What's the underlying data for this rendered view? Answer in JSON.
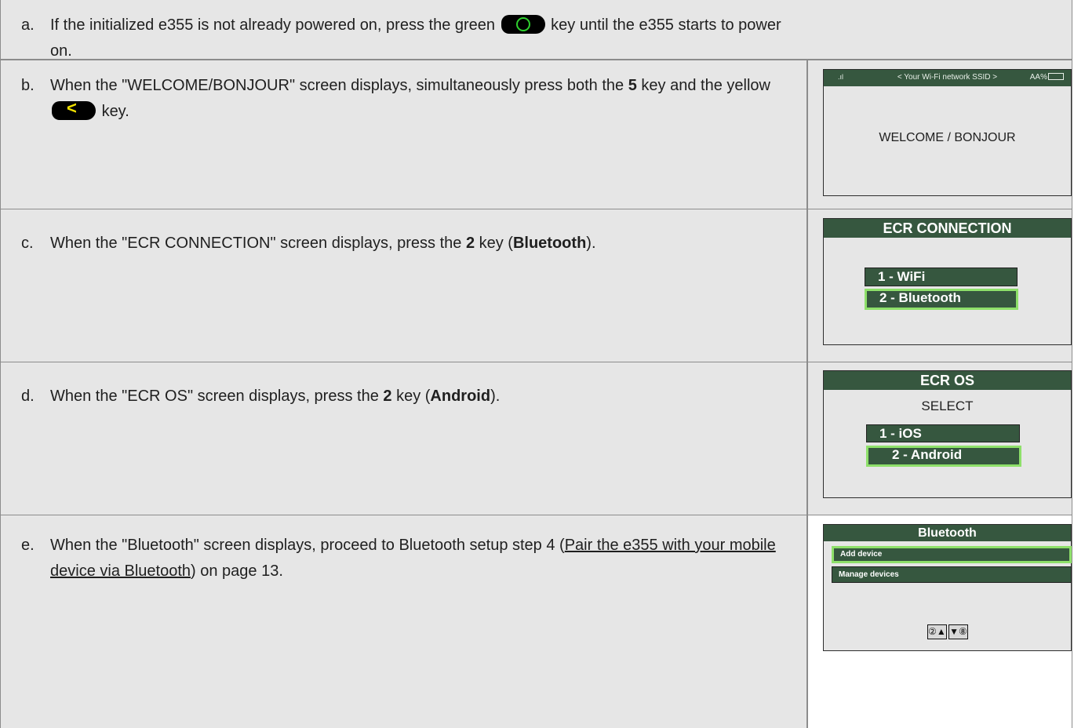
{
  "steps": {
    "a": {
      "letter": "a.",
      "text_before": "If the initialized e355 is not already powered on, press the green",
      "text_after": "key until the e355 starts to power on."
    },
    "b": {
      "letter": "b.",
      "text_1": "When the \"WELCOME/BONJOUR\" screen displays, simultaneously press both the",
      "key_number": "5",
      "text_2": "key and the yellow",
      "text_3": "key."
    },
    "c": {
      "letter": "c.",
      "text_1": "When the \"ECR CONNECTION\" screen displays, press the",
      "key_number": "2",
      "text_2": "key (",
      "bold_term": "Bluetooth",
      "text_3": ")."
    },
    "d": {
      "letter": "d.",
      "text_1": "When the \"ECR OS\" screen displays, press the",
      "key_number": "2",
      "text_2": "key (",
      "bold_term": "Android",
      "text_3": ")."
    },
    "e": {
      "letter": "e.",
      "text_1": "When the \"Bluetooth\" screen displays, proceed to Bluetooth setup step 4 (",
      "link_text": "Pair the e355 with your mobile device via Bluetooth",
      "text_2": ") on page 13."
    }
  },
  "screens": {
    "welcome": {
      "signal_glyph": ".ıl",
      "ssid": "< Your Wi-Fi network SSID >",
      "battery": "AA%",
      "message": "WELCOME / BONJOUR"
    },
    "ecr_connection": {
      "title": "ECR CONNECTION",
      "options": [
        "1 - WiFi",
        "2 - Bluetooth"
      ],
      "selected_index": 1
    },
    "ecr_os": {
      "title": "ECR OS",
      "prompt": "SELECT",
      "options": [
        "1 - iOS",
        "2 - Android"
      ],
      "selected_index": 1
    },
    "bluetooth": {
      "title": "Bluetooth",
      "options": [
        "Add device",
        "Manage devices"
      ],
      "selected_index": 0,
      "nav_up": "②▲",
      "nav_down": "▼⑧"
    }
  },
  "colors": {
    "row_bg": "#e6e6e6",
    "screen_green": "#36573f",
    "selection_border": "#8ee06a",
    "key_black": "#000000",
    "power_key_ring": "#2fd02f",
    "back_key_chevron": "#f2e200"
  },
  "icons": {
    "power_key": "green-circle-key-icon",
    "back_key": "yellow-chevron-key-icon",
    "signal": "signal-strength-icon",
    "battery": "battery-icon"
  }
}
